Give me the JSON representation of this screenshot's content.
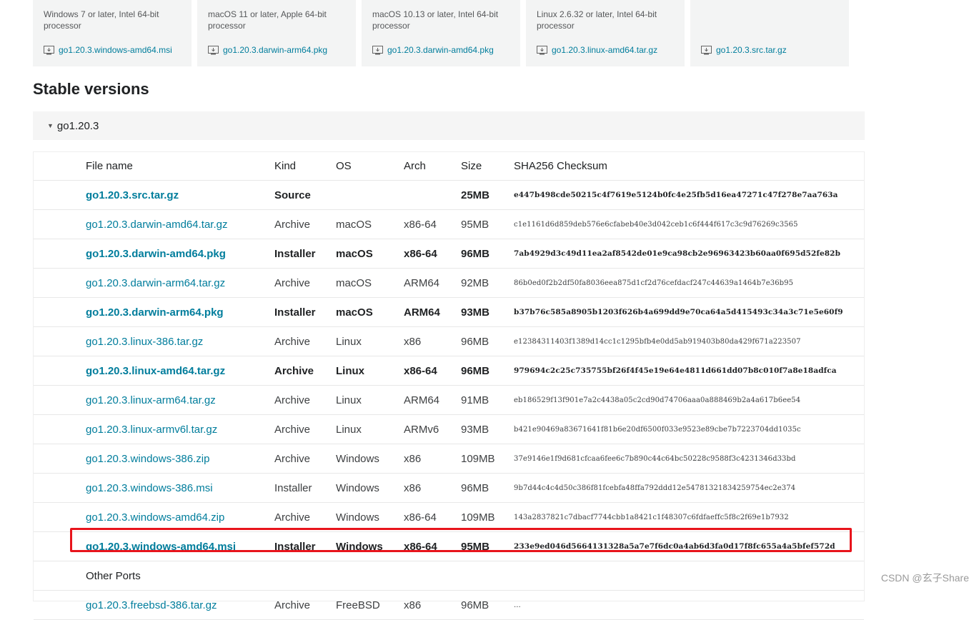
{
  "featured": [
    {
      "desc": "Windows 7 or later, Intel 64-bit processor",
      "file": "go1.20.3.windows-amd64.msi"
    },
    {
      "desc": "macOS 11 or later, Apple 64-bit processor",
      "file": "go1.20.3.darwin-arm64.pkg"
    },
    {
      "desc": "macOS 10.13 or later, Intel 64-bit processor",
      "file": "go1.20.3.darwin-amd64.pkg"
    },
    {
      "desc": "Linux 2.6.32 or later, Intel 64-bit processor",
      "file": "go1.20.3.linux-amd64.tar.gz"
    },
    {
      "desc": "",
      "file": "go1.20.3.src.tar.gz"
    }
  ],
  "stable": {
    "title": "Stable versions",
    "version": "go1.20.3"
  },
  "table": {
    "headers": {
      "file": "File name",
      "kind": "Kind",
      "os": "OS",
      "arch": "Arch",
      "size": "Size",
      "checksum": "SHA256 Checksum"
    },
    "rows": [
      {
        "file": "go1.20.3.src.tar.gz",
        "kind": "Source",
        "os": "",
        "arch": "",
        "size": "25MB",
        "checksum": "e447b498cde50215c4f7619e5124b0fc4e25fb5d16ea47271c47f278e7aa763a",
        "bold": true
      },
      {
        "file": "go1.20.3.darwin-amd64.tar.gz",
        "kind": "Archive",
        "os": "macOS",
        "arch": "x86-64",
        "size": "95MB",
        "checksum": "c1e1161d6d859deb576e6cfabeb40e3d042ceb1c6f444f617c3c9d76269c3565",
        "bold": false
      },
      {
        "file": "go1.20.3.darwin-amd64.pkg",
        "kind": "Installer",
        "os": "macOS",
        "arch": "x86-64",
        "size": "96MB",
        "checksum": "7ab4929d3c49d11ea2af8542de01e9ca98cb2e96963423b60aa0f695d52fe82b",
        "bold": true
      },
      {
        "file": "go1.20.3.darwin-arm64.tar.gz",
        "kind": "Archive",
        "os": "macOS",
        "arch": "ARM64",
        "size": "92MB",
        "checksum": "86b0ed0f2b2df50fa8036eea875d1cf2d76cefdacf247c44639a1464b7e36b95",
        "bold": false
      },
      {
        "file": "go1.20.3.darwin-arm64.pkg",
        "kind": "Installer",
        "os": "macOS",
        "arch": "ARM64",
        "size": "93MB",
        "checksum": "b37b76c585a8905b1203f626b4a699dd9e70ca64a5d415493c34a3c71e5e60f9",
        "bold": true
      },
      {
        "file": "go1.20.3.linux-386.tar.gz",
        "kind": "Archive",
        "os": "Linux",
        "arch": "x86",
        "size": "96MB",
        "checksum": "e12384311403f1389d14cc1c1295bfb4e0dd5ab919403b80da429f671a223507",
        "bold": false
      },
      {
        "file": "go1.20.3.linux-amd64.tar.gz",
        "kind": "Archive",
        "os": "Linux",
        "arch": "x86-64",
        "size": "96MB",
        "checksum": "979694c2c25c735755bf26f4f45e19e64e4811d661dd07b8c010f7a8e18adfca",
        "bold": true
      },
      {
        "file": "go1.20.3.linux-arm64.tar.gz",
        "kind": "Archive",
        "os": "Linux",
        "arch": "ARM64",
        "size": "91MB",
        "checksum": "eb186529f13f901e7a2c4438a05c2cd90d74706aaa0a888469b2a4a617b6ee54",
        "bold": false
      },
      {
        "file": "go1.20.3.linux-armv6l.tar.gz",
        "kind": "Archive",
        "os": "Linux",
        "arch": "ARMv6",
        "size": "93MB",
        "checksum": "b421e90469a83671641f81b6e20df6500f033e9523e89cbe7b7223704dd1035c",
        "bold": false
      },
      {
        "file": "go1.20.3.windows-386.zip",
        "kind": "Archive",
        "os": "Windows",
        "arch": "x86",
        "size": "109MB",
        "checksum": "37e9146e1f9d681cfcaa6fee6c7b890c44c64bc50228c9588f3c4231346d33bd",
        "bold": false
      },
      {
        "file": "go1.20.3.windows-386.msi",
        "kind": "Installer",
        "os": "Windows",
        "arch": "x86",
        "size": "96MB",
        "checksum": "9b7d44c4c4d50c386f81fcebfa48ffa792ddd12e54781321834259754ec2e374",
        "bold": false
      },
      {
        "file": "go1.20.3.windows-amd64.zip",
        "kind": "Archive",
        "os": "Windows",
        "arch": "x86-64",
        "size": "109MB",
        "checksum": "143a2837821c7dbacf7744cbb1a8421c1f48307c6fdfaeffc5f8c2f69e1b7932",
        "bold": false
      },
      {
        "file": "go1.20.3.windows-amd64.msi",
        "kind": "Installer",
        "os": "Windows",
        "arch": "x86-64",
        "size": "95MB",
        "checksum": "233e9ed046d5664131328a5a7e7f6dc0a4ab6d3fa0d17f8fc655a4a5bfef572d",
        "bold": true
      }
    ],
    "section_label": "Other Ports",
    "partial_row": {
      "file": "go1.20.3.freebsd-386.tar.gz",
      "kind": "Archive",
      "os": "FreeBSD",
      "arch": "x86",
      "size": "96MB",
      "checksum": "..."
    }
  },
  "watermark": "CSDN @玄子Share",
  "colors": {
    "link": "#007d9c",
    "highlight": "#e8141c",
    "card_bg": "#f3f4f4"
  }
}
